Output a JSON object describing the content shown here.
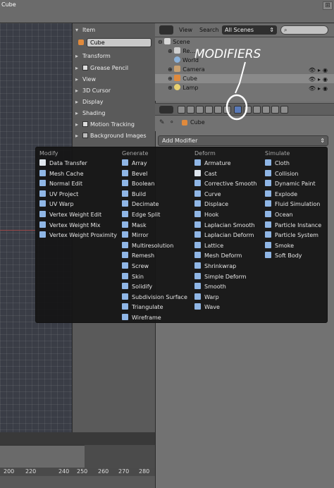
{
  "topbar": {
    "title": "Cube",
    "corner": "⊞"
  },
  "properties_panel": {
    "object_section": "Item",
    "object_name": "Cube",
    "sections": [
      "Transform",
      "Grease Pencil",
      "View",
      "3D Cursor",
      "Display",
      "Shading",
      "Motion Tracking",
      "Background Images"
    ]
  },
  "outliner": {
    "view_menu": "View",
    "search_menu": "Search",
    "scenes_select": "All Scenes",
    "rows": [
      {
        "label": "Scene"
      },
      {
        "label": "Re..."
      },
      {
        "label": "World"
      },
      {
        "label": "Camera"
      },
      {
        "label": "Cube"
      },
      {
        "label": "Lamp"
      }
    ]
  },
  "context": {
    "object": "Cube"
  },
  "add_modifier": {
    "label": "Add Modifier"
  },
  "menu": {
    "columns": [
      {
        "heading": "Modify",
        "items": [
          "Data Transfer",
          "Mesh Cache",
          "Normal Edit",
          "UV Project",
          "UV Warp",
          "Vertex Weight Edit",
          "Vertex Weight Mix",
          "Vertex Weight Proximity"
        ]
      },
      {
        "heading": "Generate",
        "items": [
          "Array",
          "Bevel",
          "Boolean",
          "Build",
          "Decimate",
          "Edge Split",
          "Mask",
          "Mirror",
          "Multiresolution",
          "Remesh",
          "Screw",
          "Skin",
          "Solidify",
          "Subdivision Surface",
          "Triangulate",
          "Wireframe"
        ]
      },
      {
        "heading": "Deform",
        "items": [
          "Armature",
          "Cast",
          "Corrective Smooth",
          "Curve",
          "Displace",
          "Hook",
          "Laplacian Smooth",
          "Laplacian Deform",
          "Lattice",
          "Mesh Deform",
          "Shrinkwrap",
          "Simple Deform",
          "Smooth",
          "Warp",
          "Wave"
        ]
      },
      {
        "heading": "Simulate",
        "items": [
          "Cloth",
          "Collision",
          "Dynamic Paint",
          "Explode",
          "Fluid Simulation",
          "Ocean",
          "Particle Instance",
          "Particle System",
          "Smoke",
          "Soft Body"
        ]
      }
    ]
  },
  "annotation": {
    "text": "MODIFIERS"
  },
  "timeline": {
    "ticks": [
      "200",
      "220",
      "240",
      "250",
      "260",
      "270",
      "280"
    ]
  },
  "colors": {
    "menu_bg": "#141414",
    "accent": "#5f8fd0",
    "annotation": "#ffffff"
  }
}
